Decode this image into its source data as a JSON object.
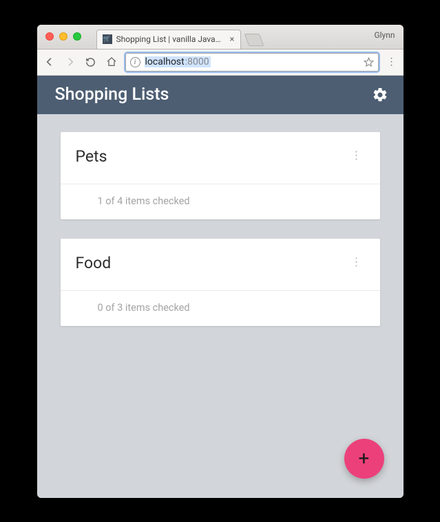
{
  "browser": {
    "profile_name": "Glynn",
    "tab_title": "Shopping List | vanilla JavaScript",
    "url_host": "localhost",
    "url_port": ":8000"
  },
  "app": {
    "header_title": "Shopping Lists"
  },
  "lists": [
    {
      "title": "Pets",
      "status": "1 of 4 items checked"
    },
    {
      "title": "Food",
      "status": "0 of 3 items checked"
    }
  ],
  "fab_label": "+"
}
